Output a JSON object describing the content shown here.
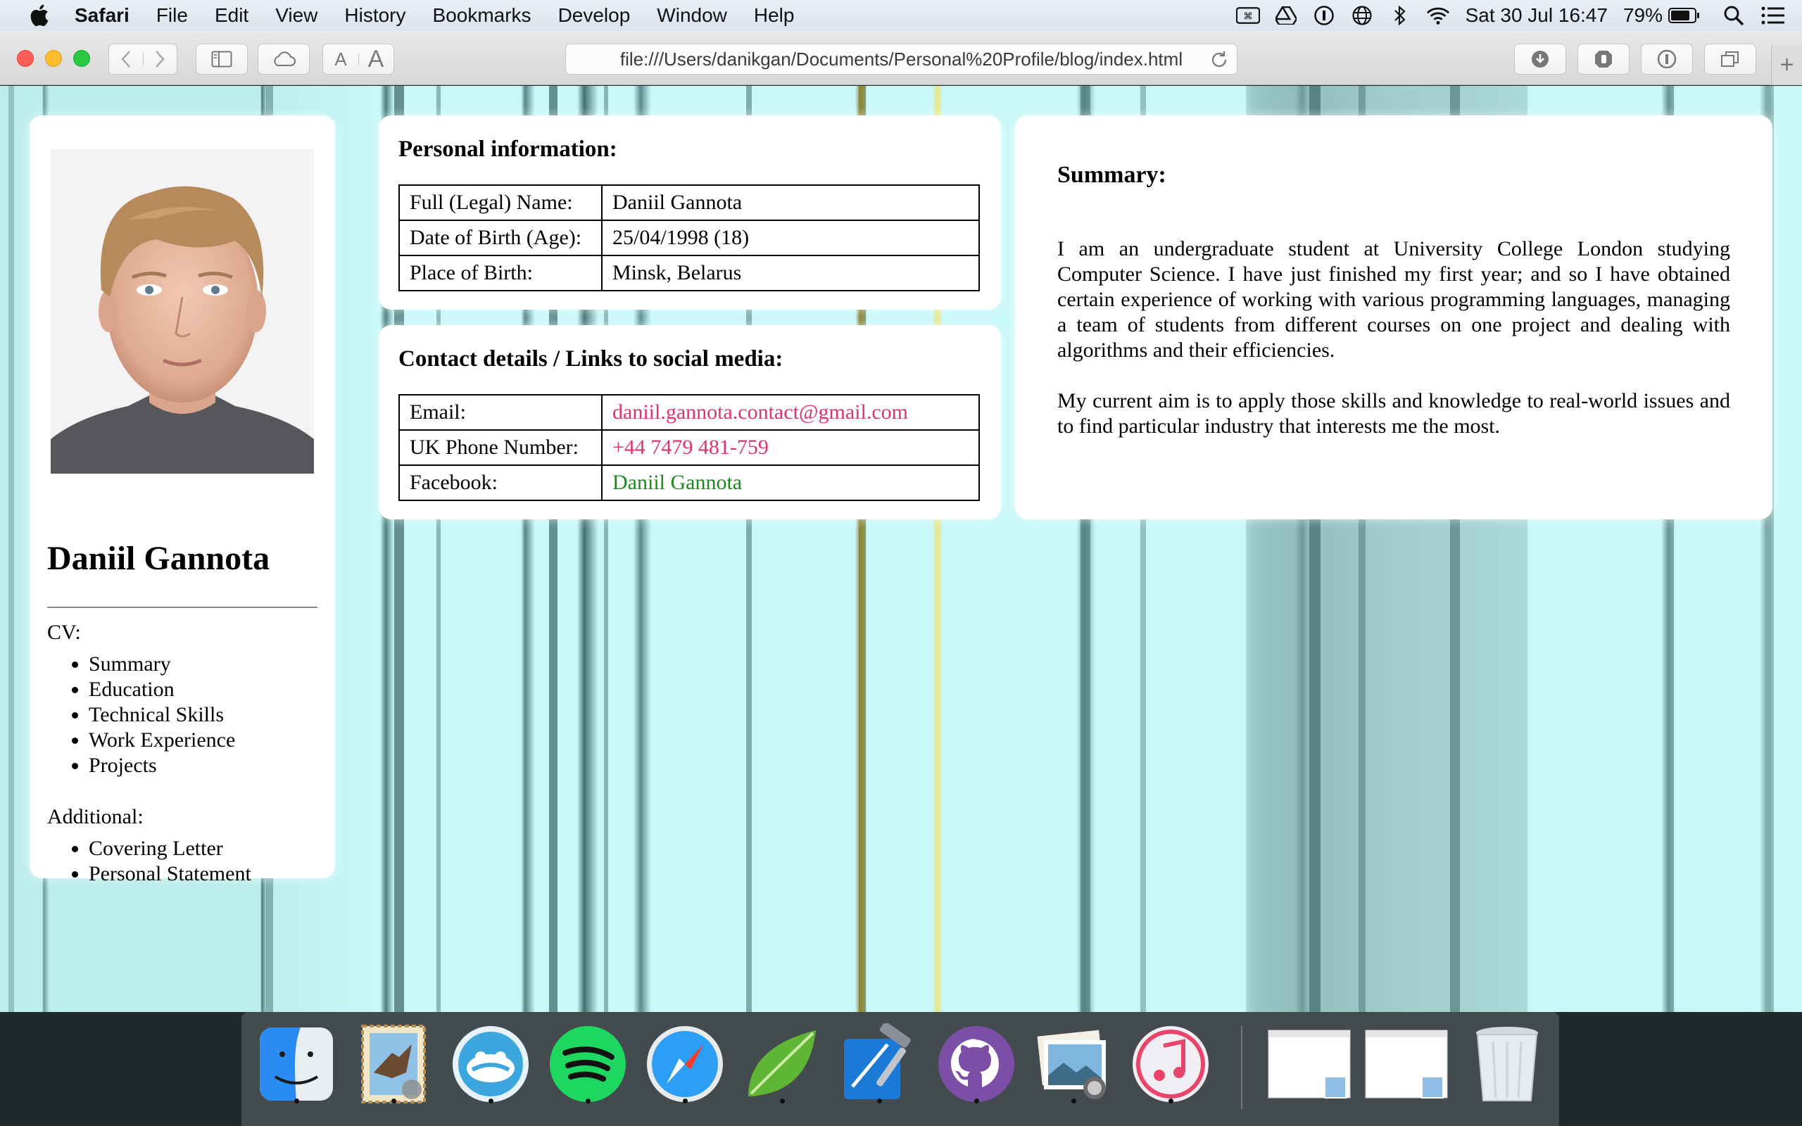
{
  "menubar": {
    "app_name": "Safari",
    "items": [
      "File",
      "Edit",
      "View",
      "History",
      "Bookmarks",
      "Develop",
      "Window",
      "Help"
    ],
    "clock": "Sat 30 Jul  16:47",
    "battery": "79%"
  },
  "toolbar": {
    "url": "file:///Users/danikgan/Documents/Personal%20Profile/blog/index.html",
    "font_small": "A",
    "font_large": "A"
  },
  "profile": {
    "name": "Daniil Gannota",
    "cv_heading": "CV:",
    "cv_links": [
      "Summary",
      "Education",
      "Technical Skills",
      "Work Experience",
      "Projects"
    ],
    "additional_heading": "Additional:",
    "additional_links": [
      "Covering Letter",
      "Personal Statement"
    ]
  },
  "personal": {
    "title": "Personal information:",
    "rows": [
      {
        "label": "Full (Legal) Name:",
        "value": "Daniil Gannota"
      },
      {
        "label": "Date of Birth (Age):",
        "value": "25/04/1998 (18)"
      },
      {
        "label": "Place of Birth:",
        "value": "Minsk, Belarus"
      }
    ]
  },
  "contact": {
    "title": "Contact details / Links to social media:",
    "rows": [
      {
        "label": "Email:",
        "value": "daniil.gannota.contact@gmail.com"
      },
      {
        "label": "UK Phone Number:",
        "value": "+44 7479 481-759"
      },
      {
        "label": "Facebook:",
        "value": "Daniil Gannota"
      }
    ]
  },
  "summary": {
    "title": "Summary:",
    "paragraph1": "I am an undergraduate student at University College London studying Computer Science. I have just finished my first year; and so I have obtained certain experience of working with various programming languages, managing a team of students from different courses on one project and dealing with algorithms and their efficiencies.",
    "paragraph2": "My current aim is to apply those skills and knowledge to real-world issues and to find particular industry that interests me the most."
  },
  "colors": {
    "link_pink": "#e0326e",
    "link_green": "#1a8a1a",
    "background": "#c9f8f8"
  },
  "dock": {
    "apps": [
      "finder-icon",
      "mail-icon",
      "tweetbot-icon",
      "spotify-icon",
      "safari-icon",
      "coda-icon",
      "xcode-icon",
      "github-icon",
      "preview-icon",
      "itunes-icon"
    ],
    "stacks": [
      "screenshot-stack-icon",
      "screenshot-stack-icon"
    ],
    "trash": "trash-icon"
  }
}
